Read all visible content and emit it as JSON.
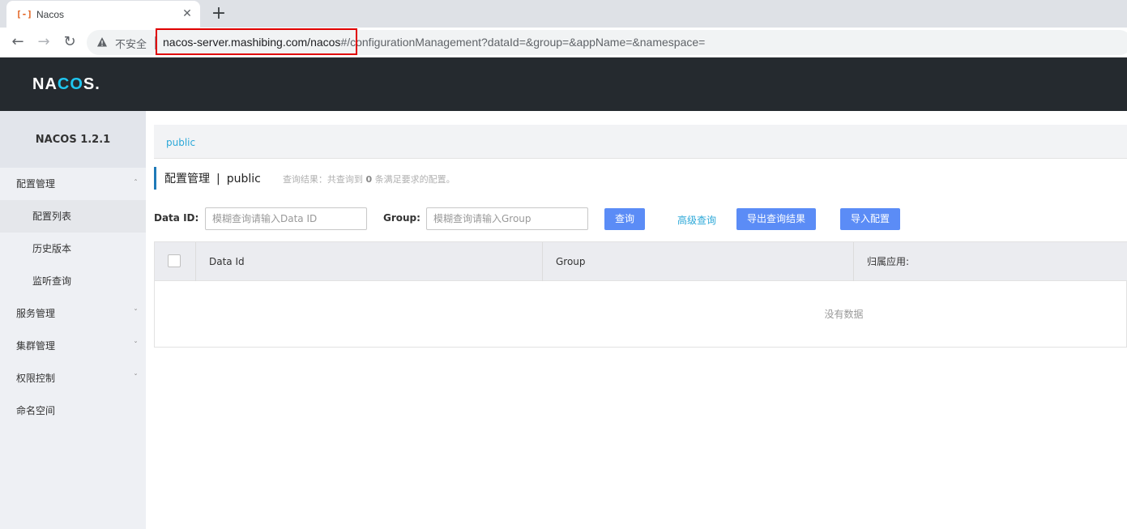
{
  "browser": {
    "tab_title": "Nacos",
    "tab_favicon": "[-]",
    "tab_close": "✕",
    "new_tab": "+",
    "security_label": "不安全",
    "url_host": "nacos-server.mashibing.com/nacos",
    "url_rest": "#/configurationManagement?dataId=&group=&appName=&namespace=",
    "nav": {
      "back": "←",
      "forward": "→",
      "reload": "↻"
    }
  },
  "header": {
    "logo_prefix": "NA",
    "logo_accent": "C",
    "logo_mid": "O",
    "logo_suffix": "S."
  },
  "sidebar": {
    "version": "NACOS 1.2.1",
    "items": [
      {
        "label": "配置管理",
        "chev": "ˆ"
      },
      {
        "label": "配置列表"
      },
      {
        "label": "历史版本"
      },
      {
        "label": "监听查询"
      },
      {
        "label": "服务管理",
        "chev": "ˇ"
      },
      {
        "label": "集群管理",
        "chev": "ˇ"
      },
      {
        "label": "权限控制",
        "chev": "ˇ"
      },
      {
        "label": "命名空间"
      }
    ]
  },
  "main": {
    "namespace": "public",
    "title": "配置管理",
    "separator": "|",
    "title_namespace": "public",
    "summary_prefix": "查询结果：共查询到",
    "summary_count": "0",
    "summary_suffix": "条满足要求的配置。",
    "filter": {
      "dataid_label": "Data ID:",
      "dataid_placeholder": "模糊查询请输入Data ID",
      "group_label": "Group:",
      "group_placeholder": "模糊查询请输入Group",
      "query_button": "查询",
      "advanced_link": "高级查询",
      "export_button": "导出查询结果",
      "import_button": "导入配置"
    },
    "table": {
      "columns": [
        "Data Id",
        "Group",
        "归属应用:"
      ],
      "empty_text": "没有数据"
    }
  },
  "colors": {
    "header_bg": "#252a2f",
    "accent": "#5b8cf6",
    "link": "#2ca8d8",
    "highlight": "#e00000"
  }
}
